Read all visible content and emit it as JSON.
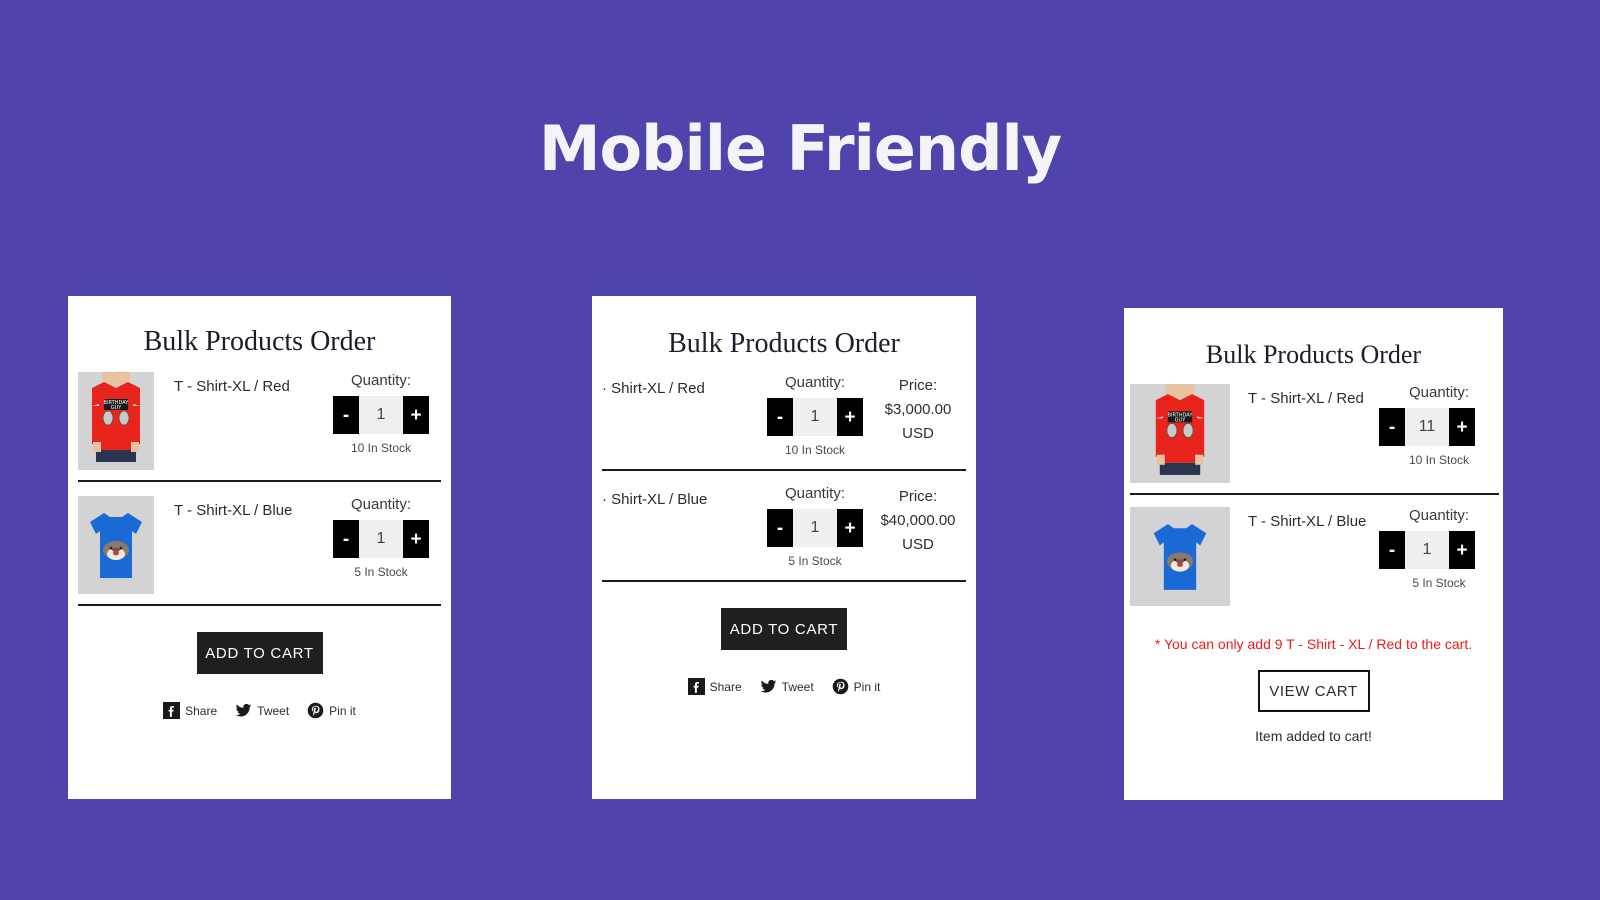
{
  "page": {
    "heading": "Mobile Friendly",
    "background_color": "#4e44ac"
  },
  "cards": {
    "card1": {
      "title": "Bulk Products Order",
      "products": [
        {
          "name": "T - Shirt-XL / Red",
          "image": "red-tshirt-birthday-guy",
          "quantity_label": "Quantity:",
          "minus": "-",
          "plus": "+",
          "quantity": "1",
          "stock": "10 In Stock"
        },
        {
          "name": "T - Shirt-XL / Blue",
          "image": "blue-tshirt-hedgehog",
          "quantity_label": "Quantity:",
          "minus": "-",
          "plus": "+",
          "quantity": "1",
          "stock": "5 In Stock"
        }
      ],
      "add_to_cart": "ADD TO CART",
      "social": [
        {
          "icon": "facebook-icon",
          "label": "Share"
        },
        {
          "icon": "twitter-icon",
          "label": "Tweet"
        },
        {
          "icon": "pinterest-icon",
          "label": "Pin it"
        }
      ]
    },
    "card2": {
      "title": "Bulk Products Order",
      "products": [
        {
          "name": "· Shirt-XL / Red",
          "quantity_label": "Quantity:",
          "minus": "-",
          "plus": "+",
          "quantity": "1",
          "stock": "10 In Stock",
          "price_label": "Price:",
          "price_amount": "$3,000.00",
          "price_currency": "USD"
        },
        {
          "name": "· Shirt-XL / Blue",
          "quantity_label": "Quantity:",
          "minus": "-",
          "plus": "+",
          "quantity": "1",
          "stock": "5 In Stock",
          "price_label": "Price:",
          "price_amount": "$40,000.00",
          "price_currency": "USD"
        }
      ],
      "add_to_cart": "ADD TO CART",
      "social": [
        {
          "icon": "facebook-icon",
          "label": "Share"
        },
        {
          "icon": "twitter-icon",
          "label": "Tweet"
        },
        {
          "icon": "pinterest-icon",
          "label": "Pin it"
        }
      ]
    },
    "card3": {
      "title": "Bulk Products Order",
      "products": [
        {
          "name": "T - Shirt-XL / Red",
          "image": "red-tshirt-birthday-guy",
          "quantity_label": "Quantity:",
          "minus": "-",
          "plus": "+",
          "quantity": "11",
          "stock": "10 In Stock"
        },
        {
          "name": "T - Shirt-XL / Blue",
          "image": "blue-tshirt-hedgehog",
          "quantity_label": "Quantity:",
          "minus": "-",
          "plus": "+",
          "quantity": "1",
          "stock": "5 In Stock"
        }
      ],
      "error_message": "* You can only add 9 T - Shirt - XL / Red to the cart.",
      "error_color": "#f01a1a",
      "view_cart": "VIEW CART",
      "status_message": "Item added to cart!"
    }
  }
}
